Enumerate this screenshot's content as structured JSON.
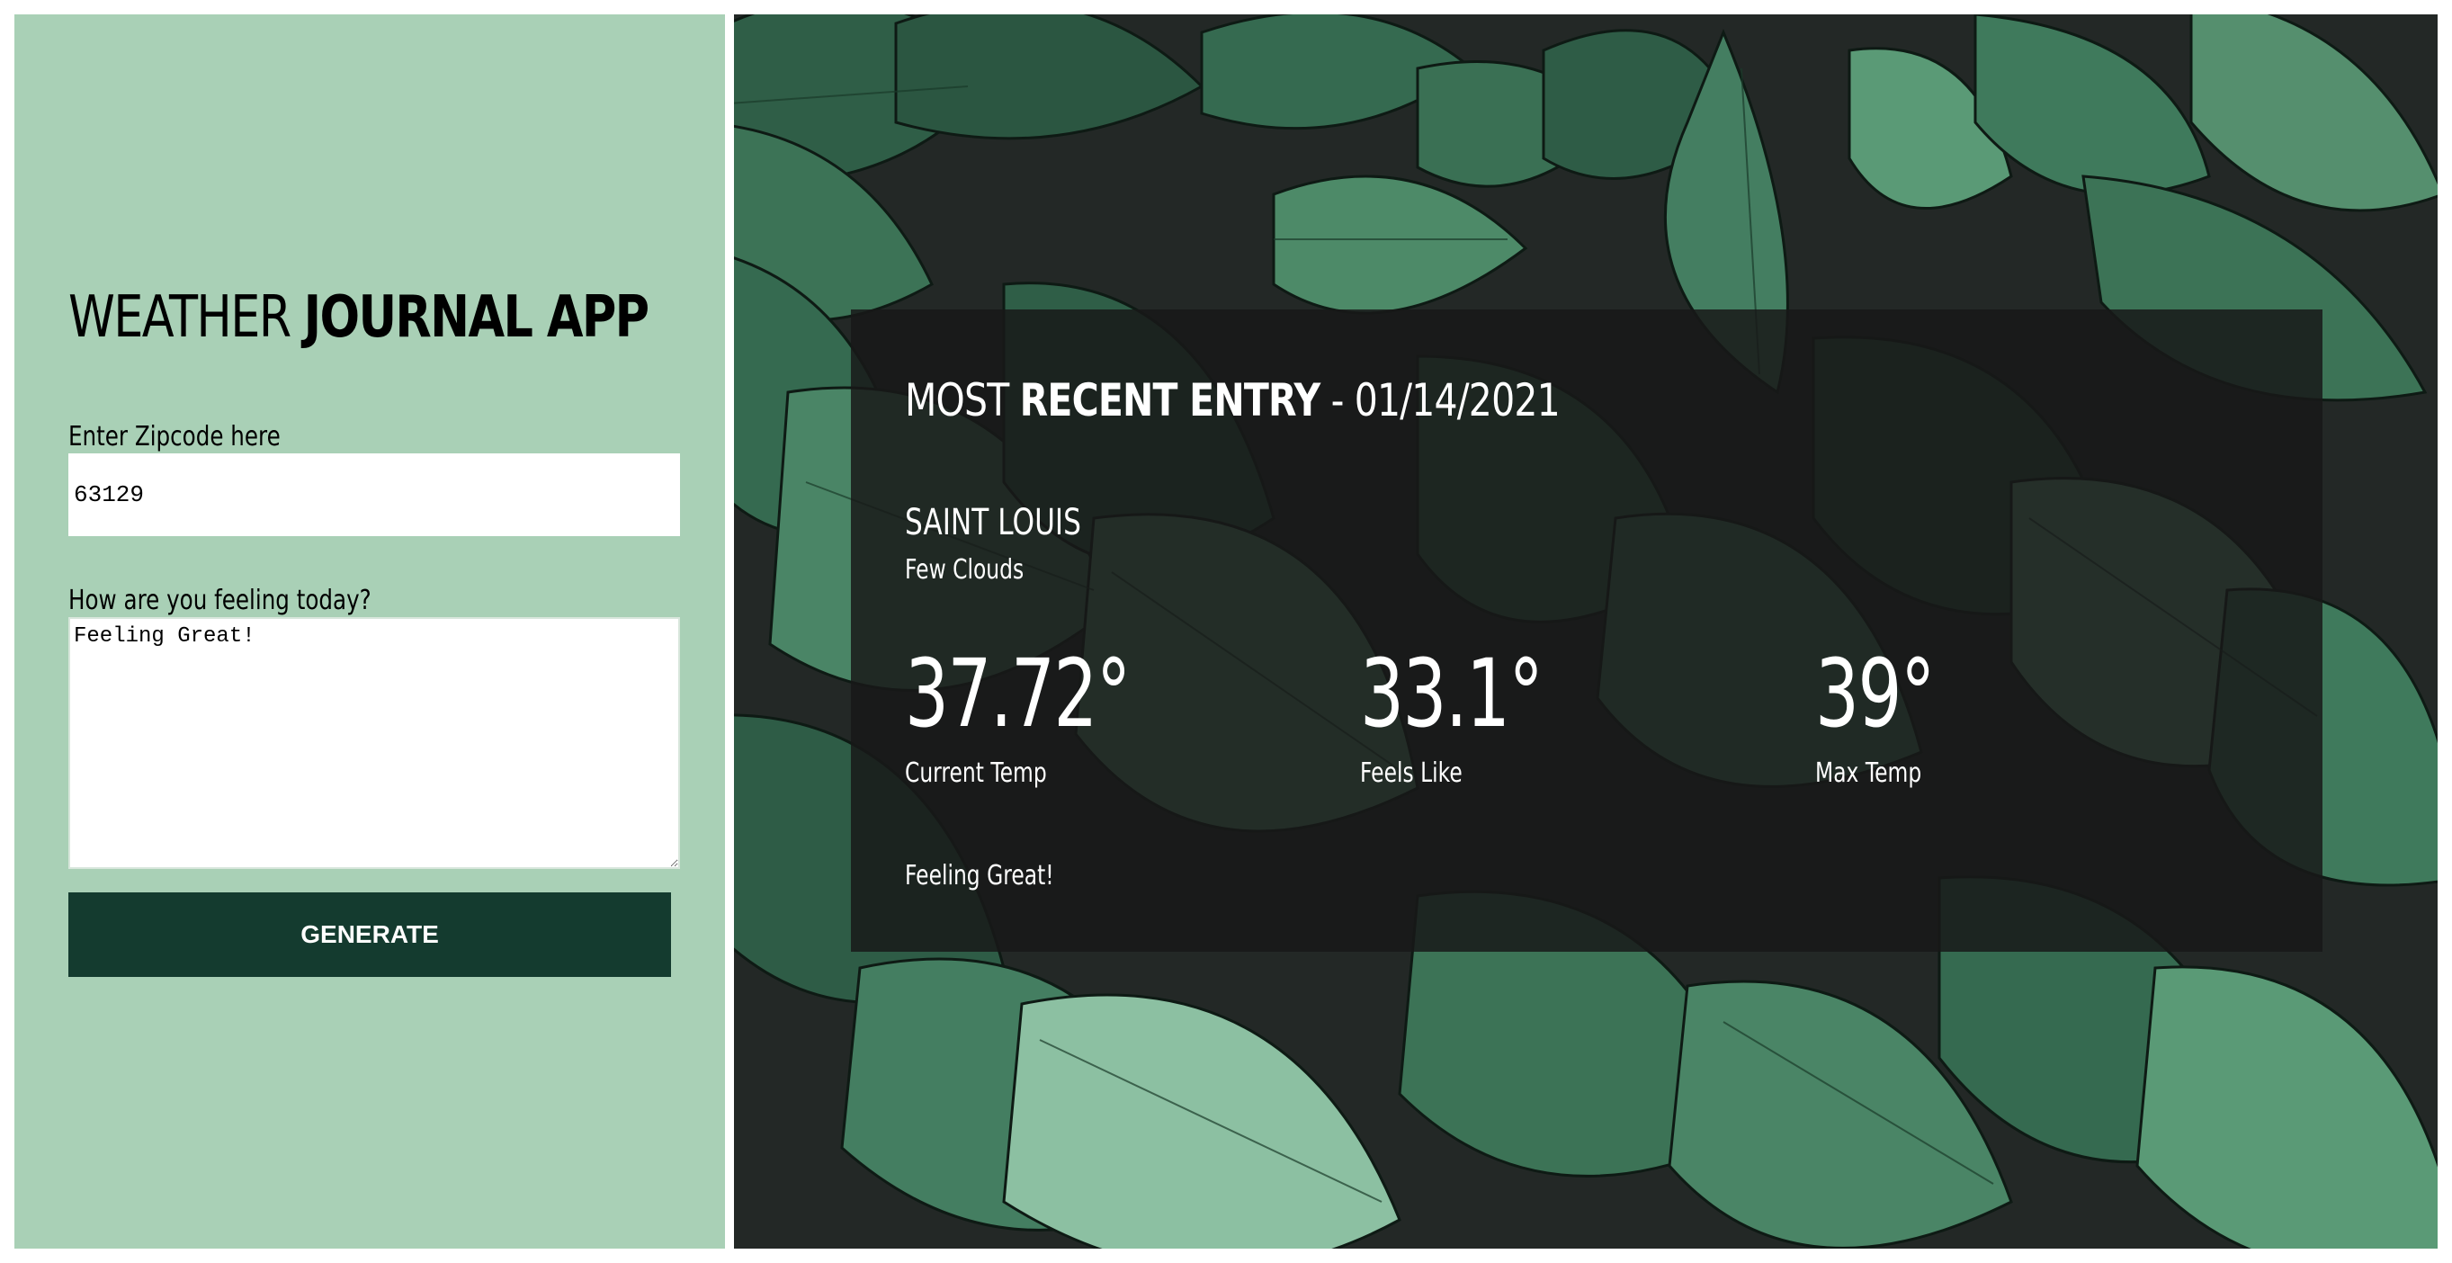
{
  "app": {
    "title_regular": "WEATHER ",
    "title_bold": "JOURNAL APP"
  },
  "form": {
    "zip_label": "Enter Zipcode here",
    "zip_value": "63129",
    "feelings_label": "How are you feeling today?",
    "feelings_value": "Feeling Great!",
    "generate_label": "GENERATE"
  },
  "entry": {
    "heading_regular": "MOST ",
    "heading_bold": "RECENT ENTRY",
    "heading_date": " - 01/14/2021",
    "city": "SAINT LOUIS",
    "description": "Few Clouds",
    "current_temp": "37.72°",
    "current_temp_label": "Current Temp",
    "feels_like": "33.1°",
    "feels_like_label": "Feels Like",
    "max_temp": "39°",
    "max_temp_label": "Max Temp",
    "feeling": "Feeling Great!"
  },
  "colors": {
    "left_panel_bg": "#a9d0b6",
    "button_bg": "#143b2f",
    "card_bg": "rgba(24,24,24,0.84)",
    "leaf_green": "#3f7a5c"
  }
}
